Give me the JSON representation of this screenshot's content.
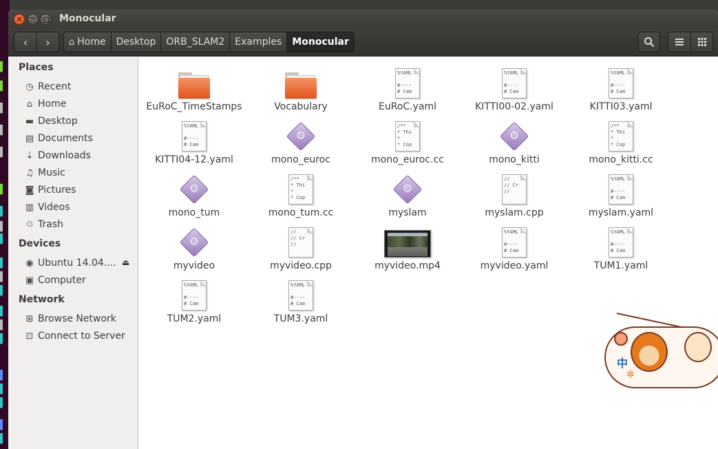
{
  "window": {
    "title": "Monocular"
  },
  "toolbar": {
    "back_icon": "back-arrow-icon",
    "forward_icon": "forward-arrow-icon",
    "breadcrumbs": [
      "Home",
      "Desktop",
      "ORB_SLAM2",
      "Examples",
      "Monocular"
    ]
  },
  "sidebar": {
    "places_heading": "Places",
    "places": [
      {
        "label": "Recent",
        "icon": "clock-icon"
      },
      {
        "label": "Home",
        "icon": "home-icon"
      },
      {
        "label": "Desktop",
        "icon": "desktop-icon"
      },
      {
        "label": "Documents",
        "icon": "documents-icon"
      },
      {
        "label": "Downloads",
        "icon": "download-icon"
      },
      {
        "label": "Music",
        "icon": "music-icon"
      },
      {
        "label": "Pictures",
        "icon": "camera-icon"
      },
      {
        "label": "Videos",
        "icon": "film-icon"
      },
      {
        "label": "Trash",
        "icon": "trash-icon"
      }
    ],
    "devices_heading": "Devices",
    "devices": [
      {
        "label": "Ubuntu 14.04....",
        "icon": "disc-icon"
      },
      {
        "label": "Computer",
        "icon": "computer-icon"
      }
    ],
    "network_heading": "Network",
    "network": [
      {
        "label": "Browse Network",
        "icon": "network-icon"
      },
      {
        "label": "Connect to Server",
        "icon": "server-icon"
      }
    ]
  },
  "files": [
    {
      "name": "EuRoC_TimeStamps",
      "type": "folder"
    },
    {
      "name": "Vocabulary",
      "type": "folder"
    },
    {
      "name": "EuRoC.yaml",
      "type": "yaml",
      "preview": "%YAML\n\n#----\n# Cam"
    },
    {
      "name": "KITTI00-02.yaml",
      "type": "yaml",
      "preview": "%YAML\n\n#----\n# Cam"
    },
    {
      "name": "KITTI03.yaml",
      "type": "yaml",
      "preview": "%YAML\n\n#----\n# Cam"
    },
    {
      "name": "KITTI04-12.yaml",
      "type": "yaml",
      "preview": "%YAML\n\n#----\n# Cam"
    },
    {
      "name": "mono_euroc",
      "type": "executable"
    },
    {
      "name": "mono_euroc.cc",
      "type": "source",
      "preview": "/**\n* Thi\n*\n* Cop"
    },
    {
      "name": "mono_kitti",
      "type": "executable"
    },
    {
      "name": "mono_kitti.cc",
      "type": "source",
      "preview": "/**\n* Thi\n*\n* Cop"
    },
    {
      "name": "mono_tum",
      "type": "executable"
    },
    {
      "name": "mono_tum.cc",
      "type": "source",
      "preview": "/**\n* Thi\n*\n* Cop"
    },
    {
      "name": "myslam",
      "type": "executable"
    },
    {
      "name": "myslam.cpp",
      "type": "source",
      "preview": "//\n// Cr\n//"
    },
    {
      "name": "myslam.yaml",
      "type": "yaml",
      "preview": "%YAML\n\n#----\n# Cam"
    },
    {
      "name": "myvideo",
      "type": "executable"
    },
    {
      "name": "myvideo.cpp",
      "type": "source",
      "preview": "//\n// Cr\n//"
    },
    {
      "name": "myvideo.mp4",
      "type": "video"
    },
    {
      "name": "myvideo.yaml",
      "type": "yaml",
      "preview": "%YAML\n\n#----\n# Cam"
    },
    {
      "name": "TUM1.yaml",
      "type": "yaml",
      "preview": "%YAML\n\n#----\n# Cam"
    },
    {
      "name": "TUM2.yaml",
      "type": "yaml",
      "preview": "%YAML\n\n#----\n# Cam"
    },
    {
      "name": "TUM3.yaml",
      "type": "yaml",
      "preview": "%YAML\n\n#----\n# Cam"
    }
  ],
  "sticker": {
    "text": "中"
  }
}
